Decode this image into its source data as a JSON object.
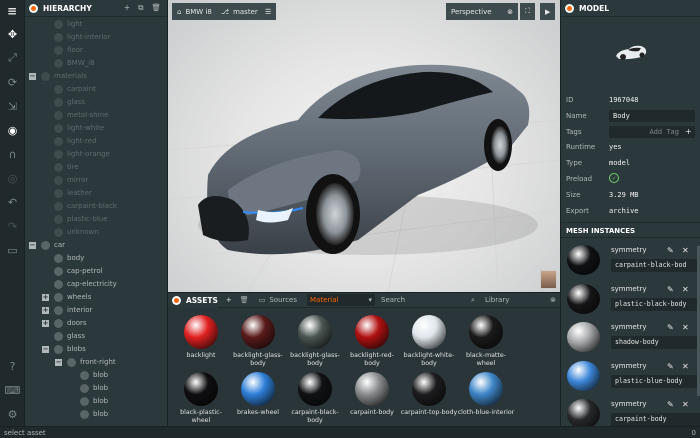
{
  "toolbar": {
    "logo": "≡",
    "tools": [
      "select-icon",
      "translate-icon",
      "rotate-icon",
      "scale-icon",
      "world-icon",
      "magnet-icon",
      "eye-icon",
      "undo-icon",
      "redo-icon",
      "comment-icon"
    ],
    "bottom": [
      "help-icon",
      "keyboard-icon",
      "settings-icon"
    ]
  },
  "hierarchy": {
    "title": "HIERARCHY",
    "items": [
      {
        "label": "light",
        "depth": 1,
        "toggle": "",
        "dim": true,
        "kind": "light"
      },
      {
        "label": "light-interior",
        "depth": 1,
        "toggle": "",
        "dim": true,
        "kind": "light"
      },
      {
        "label": "floor",
        "depth": 1,
        "toggle": "",
        "dim": true,
        "kind": "entity"
      },
      {
        "label": "BMW_i8",
        "depth": 1,
        "toggle": "",
        "dim": true,
        "kind": "entity"
      },
      {
        "label": "materials",
        "depth": 0,
        "toggle": "−",
        "dim": true,
        "kind": "entity"
      },
      {
        "label": "carpaint",
        "depth": 1,
        "toggle": "",
        "dim": true,
        "kind": "entity"
      },
      {
        "label": "glass",
        "depth": 1,
        "toggle": "",
        "dim": true,
        "kind": "entity"
      },
      {
        "label": "metal-shine",
        "depth": 1,
        "toggle": "",
        "dim": true,
        "kind": "entity"
      },
      {
        "label": "light-white",
        "depth": 1,
        "toggle": "",
        "dim": true,
        "kind": "entity"
      },
      {
        "label": "light-red",
        "depth": 1,
        "toggle": "",
        "dim": true,
        "kind": "entity"
      },
      {
        "label": "light-orange",
        "depth": 1,
        "toggle": "",
        "dim": true,
        "kind": "entity"
      },
      {
        "label": "tire",
        "depth": 1,
        "toggle": "",
        "dim": true,
        "kind": "entity"
      },
      {
        "label": "mirror",
        "depth": 1,
        "toggle": "",
        "dim": true,
        "kind": "entity"
      },
      {
        "label": "leather",
        "depth": 1,
        "toggle": "",
        "dim": true,
        "kind": "entity"
      },
      {
        "label": "carpaint-black",
        "depth": 1,
        "toggle": "",
        "dim": true,
        "kind": "entity"
      },
      {
        "label": "plastic-blue",
        "depth": 1,
        "toggle": "",
        "dim": true,
        "kind": "entity"
      },
      {
        "label": "unknown",
        "depth": 1,
        "toggle": "",
        "dim": true,
        "kind": "entity"
      },
      {
        "label": "car",
        "depth": 0,
        "toggle": "−",
        "dim": false,
        "kind": "entity"
      },
      {
        "label": "body",
        "depth": 1,
        "toggle": "",
        "dim": false,
        "kind": "entity"
      },
      {
        "label": "cap-petrol",
        "depth": 1,
        "toggle": "",
        "dim": false,
        "kind": "entity"
      },
      {
        "label": "cap-electricity",
        "depth": 1,
        "toggle": "",
        "dim": false,
        "kind": "entity"
      },
      {
        "label": "wheels",
        "depth": 1,
        "toggle": "+",
        "dim": false,
        "kind": "entity"
      },
      {
        "label": "interior",
        "depth": 1,
        "toggle": "+",
        "dim": false,
        "kind": "entity"
      },
      {
        "label": "doors",
        "depth": 1,
        "toggle": "+",
        "dim": false,
        "kind": "entity"
      },
      {
        "label": "glass",
        "depth": 1,
        "toggle": "",
        "dim": false,
        "kind": "entity"
      },
      {
        "label": "blobs",
        "depth": 1,
        "toggle": "−",
        "dim": false,
        "kind": "entity"
      },
      {
        "label": "front-right",
        "depth": 2,
        "toggle": "−",
        "dim": false,
        "kind": "entity"
      },
      {
        "label": "blob",
        "depth": 3,
        "toggle": "",
        "dim": false,
        "kind": "entity"
      },
      {
        "label": "blob",
        "depth": 3,
        "toggle": "",
        "dim": false,
        "kind": "entity"
      },
      {
        "label": "blob",
        "depth": 3,
        "toggle": "",
        "dim": false,
        "kind": "entity"
      },
      {
        "label": "blob",
        "depth": 3,
        "toggle": "",
        "dim": false,
        "kind": "entity"
      }
    ]
  },
  "viewport": {
    "project": "BMW i8",
    "branch": "master",
    "camera": "Perspective"
  },
  "assets": {
    "title": "ASSETS",
    "sources_label": "Sources",
    "filter_label": "Material",
    "search_placeholder": "Search",
    "library_label": "Library",
    "items": [
      {
        "label": "backlight",
        "color": "#e02020"
      },
      {
        "label": "backlight-glass-body",
        "color": "#5a1a1a"
      },
      {
        "label": "backlight-glass-body",
        "color": "#4a5552"
      },
      {
        "label": "backlight-red-body",
        "color": "#b01010"
      },
      {
        "label": "backlight-white-body",
        "color": "#dfe6ec"
      },
      {
        "label": "black-matte-wheel",
        "color": "#1a1a1a"
      },
      {
        "label": "black-plastic-wheel",
        "color": "#0e0e10"
      },
      {
        "label": "brakes-wheel",
        "color": "#2e7fd8"
      },
      {
        "label": "carpaint-black-body",
        "color": "#101214"
      },
      {
        "label": "carpaint-body",
        "color": "#8a8c8e"
      },
      {
        "label": "carpaint-top-body",
        "color": "#1c1c1e"
      },
      {
        "label": "cloth-blue-interior",
        "color": "#3e86c8"
      }
    ]
  },
  "inspector": {
    "title": "MODEL",
    "fields": [
      {
        "label": "ID",
        "value": "1967048"
      },
      {
        "label": "Name",
        "value": "Body"
      },
      {
        "label": "Tags",
        "value": "Add Tag"
      },
      {
        "label": "Runtime",
        "value": "yes"
      },
      {
        "label": "Type",
        "value": "model"
      },
      {
        "label": "Preload",
        "value": "✓"
      },
      {
        "label": "Size",
        "value": "3.29 MB"
      },
      {
        "label": "Export",
        "value": "archive"
      }
    ],
    "mesh_title": "MESH INSTANCES",
    "mesh_instances": [
      {
        "title": "symmetry",
        "material": "carpaint-black-bod",
        "color": "#0f1113"
      },
      {
        "title": "symmetry",
        "material": "plastic-black-body",
        "color": "#151517"
      },
      {
        "title": "symmetry",
        "material": "shadow-body",
        "color": "#a3a5a6"
      },
      {
        "title": "symmetry",
        "material": "plastic-blue-body",
        "color": "#3b86d8"
      },
      {
        "title": "symmetry",
        "material": "carpaint-body",
        "color": "#26282a"
      }
    ]
  },
  "status": {
    "text": "select asset",
    "count": "0"
  }
}
